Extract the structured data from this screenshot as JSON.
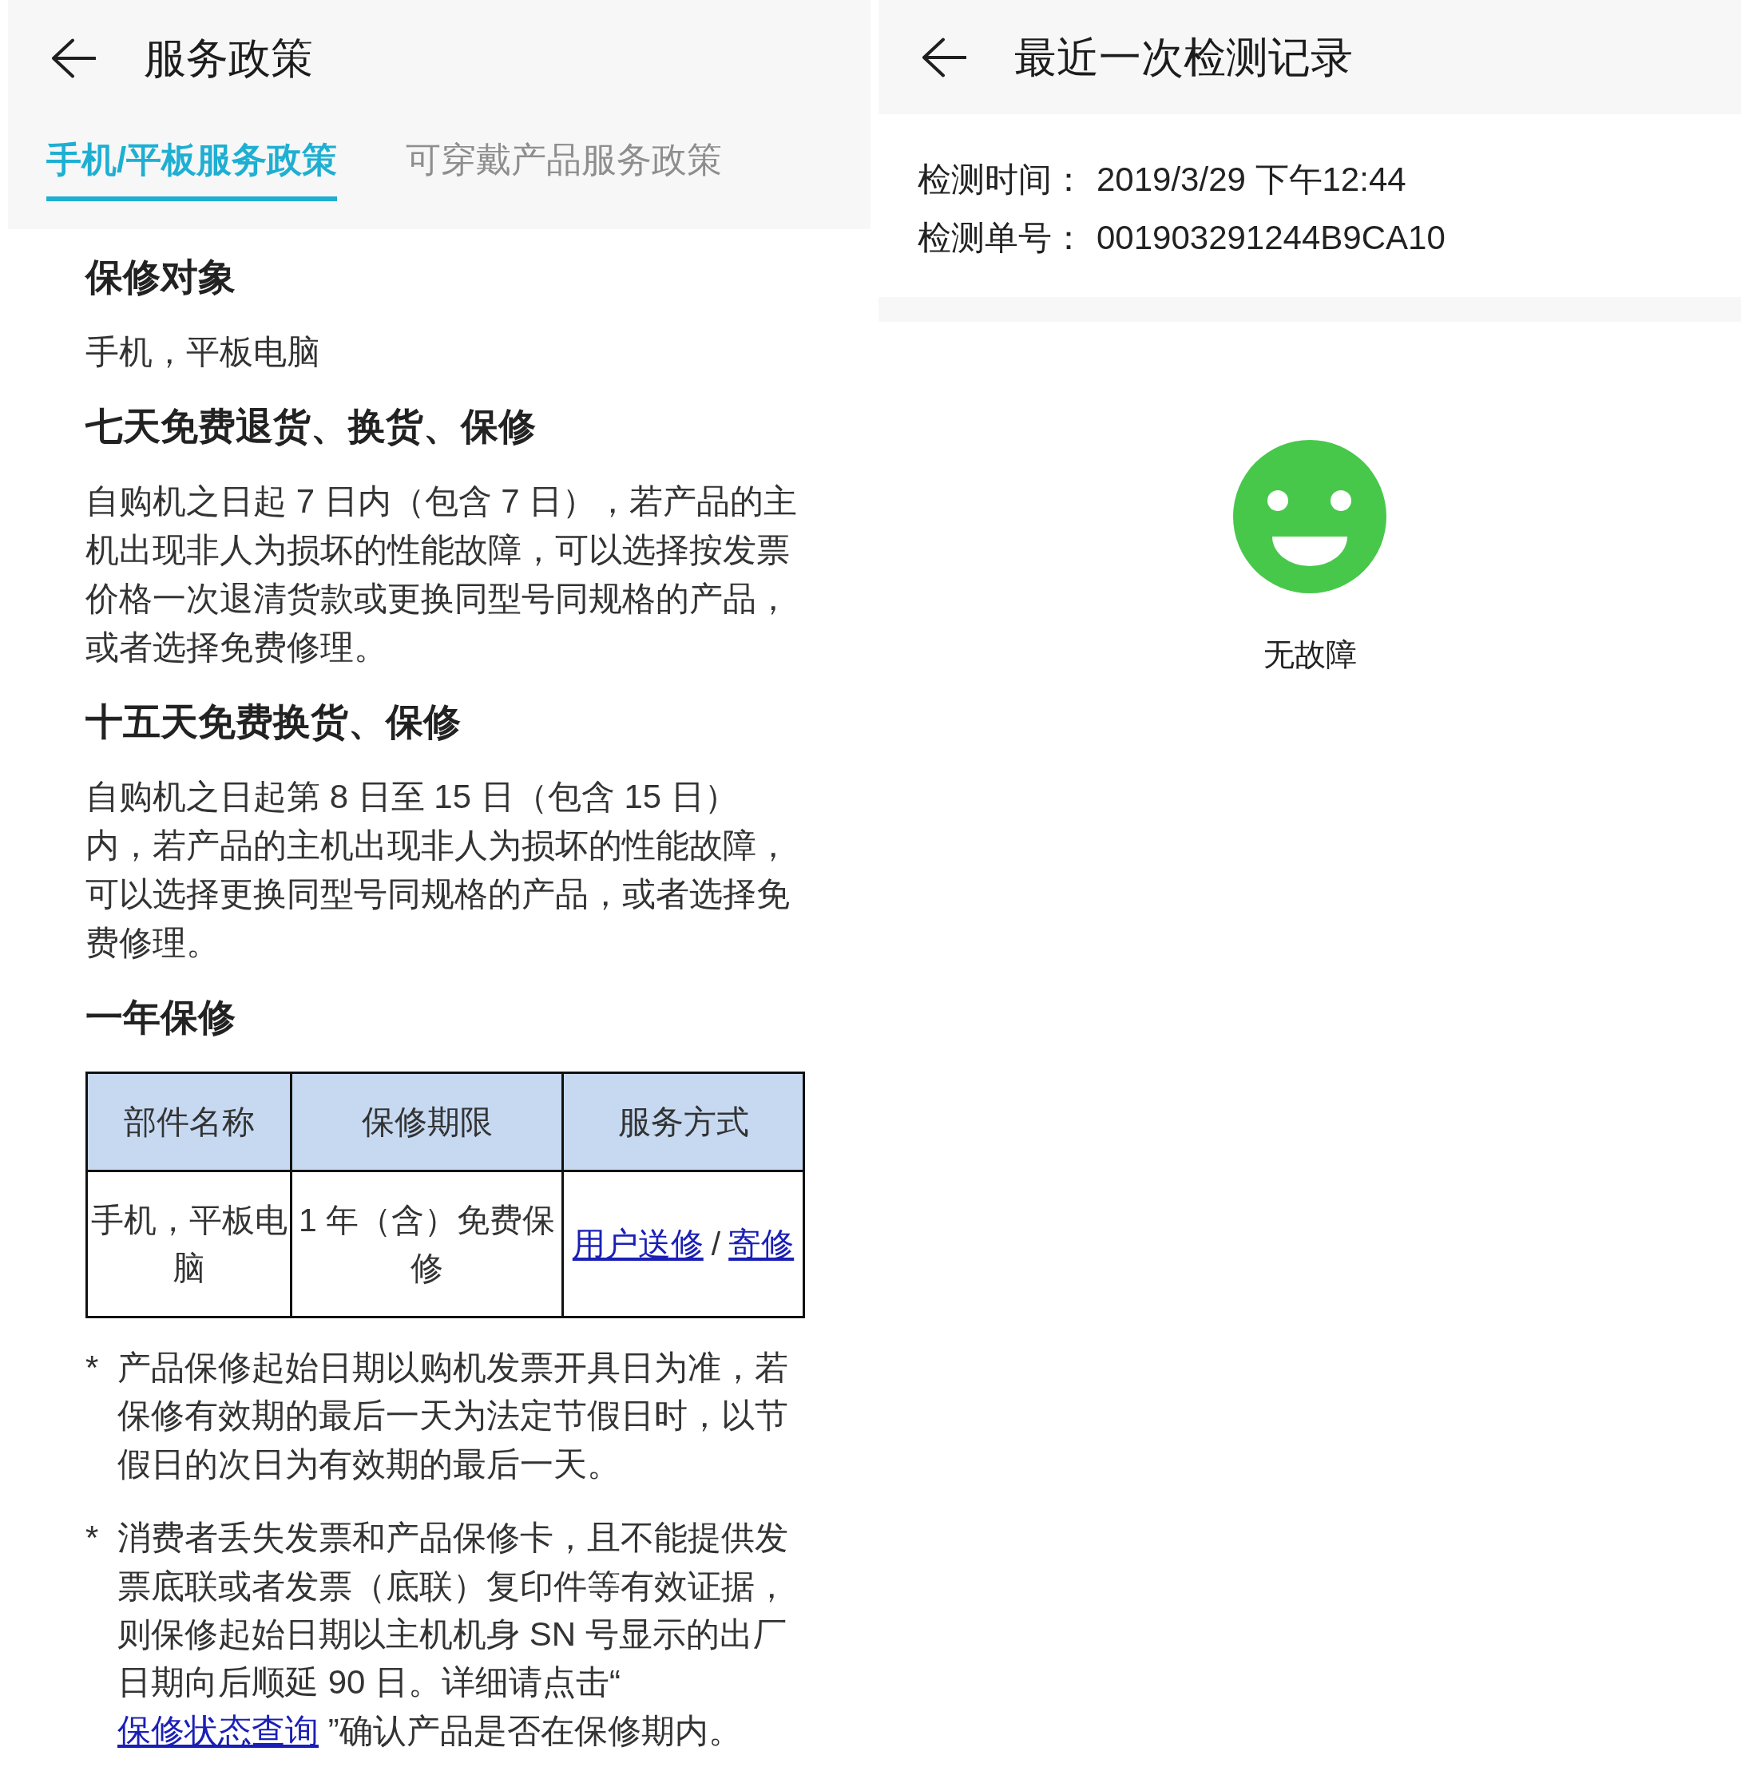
{
  "service_policy_screen": {
    "title": "服务政策",
    "tabs": [
      {
        "label": "手机/平板服务政策",
        "selected": true
      },
      {
        "label": "可穿戴产品服务政策",
        "selected": false
      }
    ],
    "sections": [
      {
        "kind": "heading",
        "text": "保修对象"
      },
      {
        "kind": "paragraph",
        "text": "手机，平板电脑"
      },
      {
        "kind": "heading",
        "text": "七天免费退货、换货、保修"
      },
      {
        "kind": "paragraph",
        "text": "自购机之日起 7 日内（包含 7 日），若产品的主机出现非人为损坏的性能故障，可以选择按发票价格一次退清货款或更换同型号同规格的产品，或者选择免费修理。"
      },
      {
        "kind": "heading",
        "text": "十五天免费换货、保修"
      },
      {
        "kind": "paragraph",
        "text": "自购机之日起第 8 日至 15 日（包含 15 日）内，若产品的主机出现非人为损坏的性能故障，可以选择更换同型号同规格的产品，或者选择免费修理。"
      },
      {
        "kind": "heading",
        "text": "一年保修"
      },
      {
        "kind": "table",
        "columns": [
          "部件名称",
          "保修期限",
          "服务方式"
        ],
        "rows": [
          [
            [
              {
                "kind": "text",
                "text": "手机，平板电脑"
              }
            ],
            [
              {
                "kind": "text",
                "text": "1 年（含）免费保修"
              }
            ],
            [
              {
                "kind": "link",
                "text": "用户送修"
              },
              {
                "kind": "text",
                "text": "/"
              },
              {
                "kind": "link",
                "text": "寄修"
              }
            ]
          ]
        ]
      },
      {
        "kind": "footnote",
        "marker": "*",
        "parts": [
          {
            "kind": "text",
            "text": "产品保修起始日期以购机发票开具日为准，若保修有效期的最后一天为法定节假日时，以节假日的次日为有效期的最后一天。"
          }
        ]
      },
      {
        "kind": "footnote",
        "marker": "*",
        "parts": [
          {
            "kind": "text",
            "text": "消费者丢失发票和产品保修卡，且不能提供发票底联或者发票（底联）复印件等有效证据，则保修起始日期以主机机身 SN 号显示的出厂日期向后顺延 90 日。详细请点击“ "
          },
          {
            "kind": "link",
            "text": "保修状态查询"
          },
          {
            "kind": "text",
            "text": " ”确认产品是否在保修期内。"
          }
        ]
      }
    ]
  },
  "inspection_record_screen": {
    "title": "最近一次检测记录",
    "fields": [
      {
        "label": "检测时间：",
        "value": "2019/3/29 下午12:44"
      },
      {
        "label": "检测单号：",
        "value": "001903291244B9CA10"
      }
    ],
    "result": {
      "faulty": false,
      "label": "无故障"
    }
  }
}
